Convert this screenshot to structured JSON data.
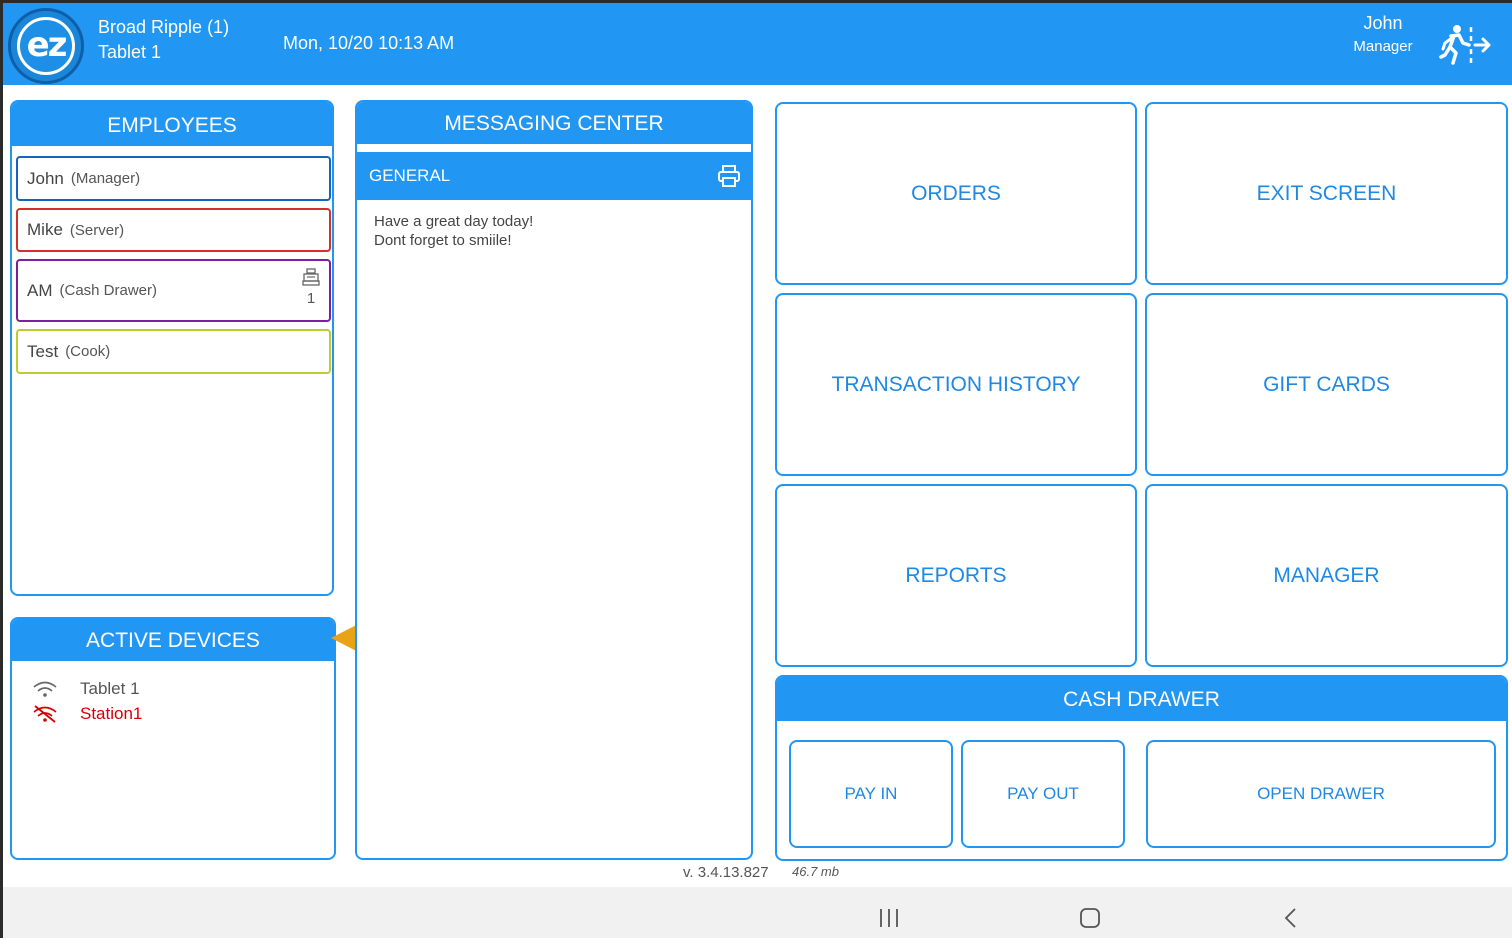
{
  "header": {
    "logo_text": "ez",
    "location": "Broad Ripple (1)",
    "device": "Tablet 1",
    "datetime": "Mon, 10/20 10:13 AM",
    "user_name": "John",
    "user_role": "Manager"
  },
  "employees": {
    "title": "EMPLOYEES",
    "items": [
      {
        "name": "John",
        "role": "(Manager)",
        "color": "#1565c0"
      },
      {
        "name": "Mike",
        "role": "(Server)",
        "color": "#d32f2f"
      },
      {
        "name": "AM",
        "role": "(Cash Drawer)",
        "color": "#7b1fa2",
        "drawer": "1"
      },
      {
        "name": "Test",
        "role": "(Cook)",
        "color": "#c0ca33"
      }
    ]
  },
  "active_devices": {
    "title": "ACTIVE DEVICES",
    "items": [
      {
        "name": "Tablet 1",
        "status": "online",
        "color": "#555555"
      },
      {
        "name": "Station1",
        "status": "offline",
        "color": "#d50000"
      }
    ]
  },
  "messaging": {
    "title": "MESSAGING CENTER",
    "channel": "GENERAL",
    "lines": [
      "Have a great day today!",
      "Dont forget to smiile!"
    ]
  },
  "tiles": {
    "orders": "ORDERS",
    "exit_screen": "EXIT SCREEN",
    "transaction_history": "TRANSACTION HISTORY",
    "gift_cards": "GIFT CARDS",
    "reports": "REPORTS",
    "manager": "MANAGER"
  },
  "cash_drawer": {
    "title": "CASH DRAWER",
    "pay_in": "PAY IN",
    "pay_out": "PAY OUT",
    "open_drawer": "OPEN DRAWER"
  },
  "footer": {
    "version": "v. 3.4.13.827",
    "memory": "46.7  mb"
  },
  "colors": {
    "accent": "#2196f3",
    "tile_text": "#1e88e5",
    "arrow": "#e8a317",
    "offline": "#d50000"
  }
}
